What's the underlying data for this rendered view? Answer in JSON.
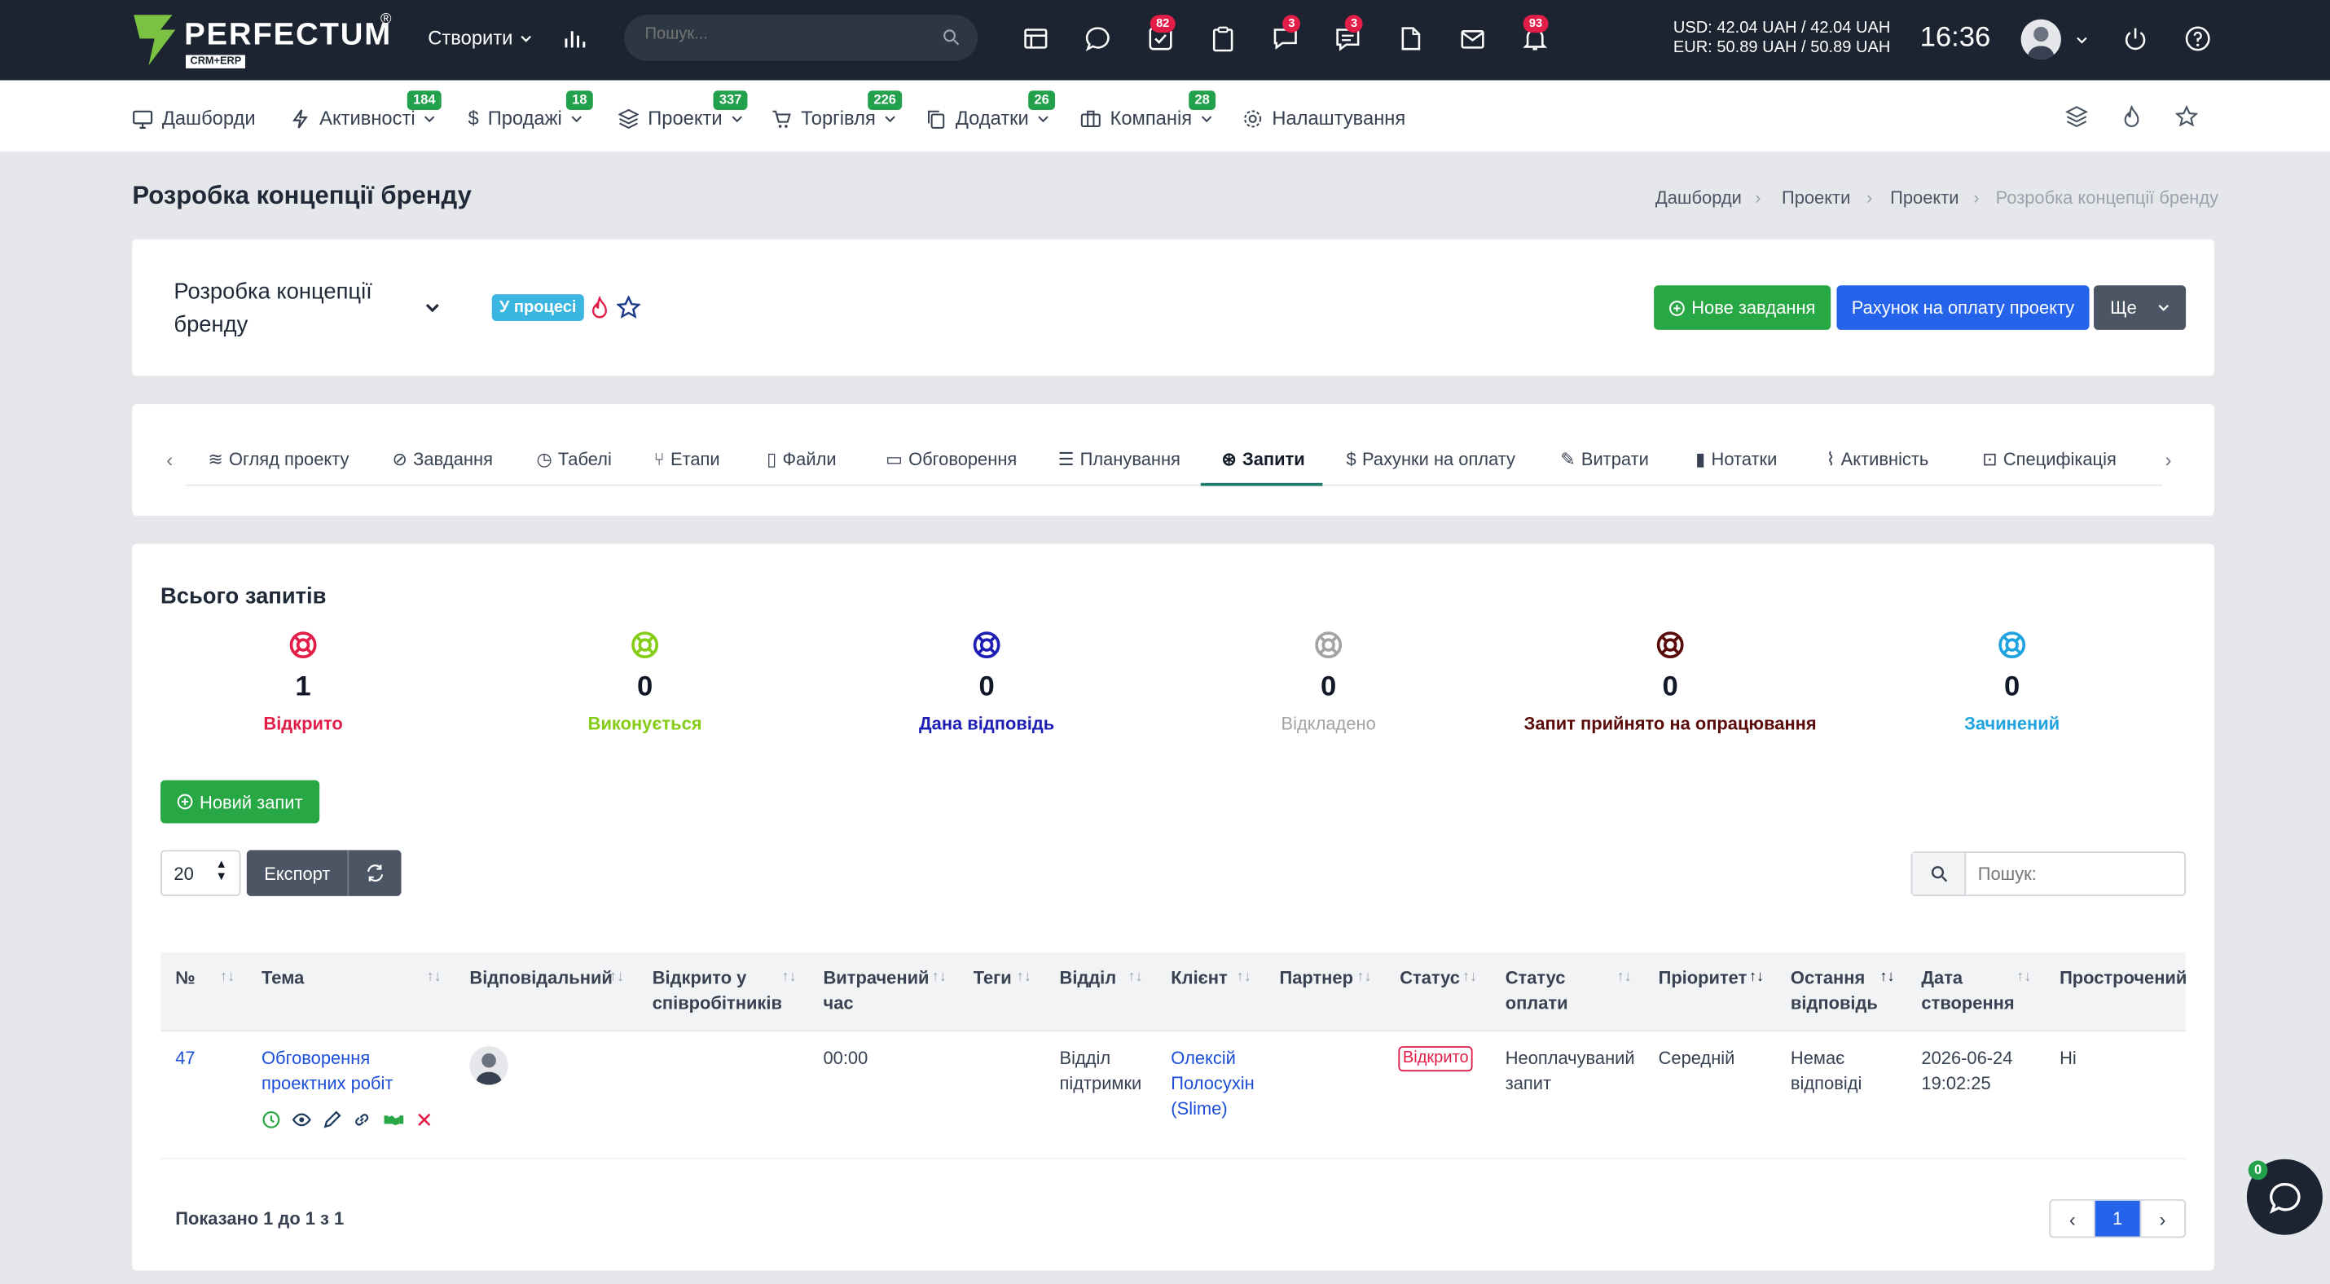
{
  "brand": {
    "name": "PERFECTUM",
    "reg": "®",
    "sub": "CRM+ERP"
  },
  "topbar": {
    "create_label": "Створити",
    "search_placeholder": "Пошук...",
    "badges": {
      "tasks": "82",
      "chat": "3",
      "comments": "3",
      "notifications": "93"
    },
    "rates": {
      "usd": "USD: 42.04 UAH / 42.04 UAH",
      "eur": "EUR: 50.89 UAH / 50.89 UAH"
    },
    "time": "16:36"
  },
  "nav": {
    "items": [
      {
        "label": "Дашборди",
        "badge": ""
      },
      {
        "label": "Активності",
        "badge": "184"
      },
      {
        "label": "Продажі",
        "badge": "18"
      },
      {
        "label": "Проекти",
        "badge": "337"
      },
      {
        "label": "Торгівля",
        "badge": "226"
      },
      {
        "label": "Додатки",
        "badge": "26"
      },
      {
        "label": "Компанія",
        "badge": "28"
      },
      {
        "label": "Налаштування",
        "badge": ""
      }
    ]
  },
  "page": {
    "title": "Розробка концепції бренду",
    "breadcrumb": [
      "Дашборди",
      "Проекти",
      "Проекти",
      "Розробка концепції бренду"
    ]
  },
  "project": {
    "name_line1": "Розробка концепції",
    "name_line2": "бренду",
    "status": "У процесі",
    "btn_new_task": "Нове завдання",
    "btn_invoice": "Рахунок на оплату проекту",
    "btn_more": "Ще"
  },
  "tabs": [
    "Огляд проекту",
    "Завдання",
    "Табелі",
    "Етапи",
    "Файли",
    "Обговорення",
    "Планування",
    "Запити",
    "Рахунки на оплату",
    "Витрати",
    "Нотатки",
    "Активність",
    "Специфікація"
  ],
  "summary": {
    "title": "Всього запитів",
    "stats": [
      {
        "count": "1",
        "label": "Відкрито",
        "color": "#e11d48"
      },
      {
        "count": "0",
        "label": "Виконується",
        "color": "#84cc16"
      },
      {
        "count": "0",
        "label": "Дана відповідь",
        "color": "#1e1eb4"
      },
      {
        "count": "0",
        "label": "Відкладено",
        "color": "#a3a3a3"
      },
      {
        "count": "0",
        "label": "Запит прийнято на опрацювання",
        "color": "#5b0a0a"
      },
      {
        "count": "0",
        "label": "Зачинений",
        "color": "#1fa3e0"
      }
    ]
  },
  "toolbar": {
    "new_request": "Новий запит",
    "page_size": "20",
    "export": "Експорт",
    "search_placeholder": "Пошук:"
  },
  "table": {
    "headers": {
      "num": "№",
      "topic": "Тема",
      "responsible": "Відповідальний",
      "open_l1": "Відкрито у",
      "open_l2": "співробітників",
      "time_l1": "Витрачений",
      "time_l2": "час",
      "tags": "Теги",
      "dept": "Відділ",
      "client": "Клієнт",
      "partner": "Партнер",
      "status": "Статус",
      "pay_l1": "Статус",
      "pay_l2": "оплати",
      "priority": "Пріоритет",
      "last_l1": "Остання",
      "last_l2": "відповідь",
      "created_l1": "Дата",
      "created_l2": "створення",
      "overdue": "Прострочений"
    },
    "row": {
      "num": "47",
      "topic_l1": "Обговорення",
      "topic_l2": "проектних робіт",
      "time": "00:00",
      "dept_l1": "Відділ",
      "dept_l2": "підтримки",
      "client_l1": "Олексій",
      "client_l2": "Полосухін",
      "client_l3": "(Slime)",
      "status": "Відкрито",
      "pay_l1": "Неоплачуваний",
      "pay_l2": "запит",
      "priority": "Середній",
      "last_l1": "Немає",
      "last_l2": "відповіді",
      "created_l1": "2026-06-24",
      "created_l2": "19:02:25",
      "overdue": "Ні"
    }
  },
  "footer": {
    "shown": "Показано 1 до 1 з 1",
    "page": "1",
    "chat_badge": "0"
  },
  "colors": {
    "topbar": "#1b2430",
    "green": "#28a745",
    "blue": "#2563eb",
    "status_cyan": "#3bb6e0"
  }
}
